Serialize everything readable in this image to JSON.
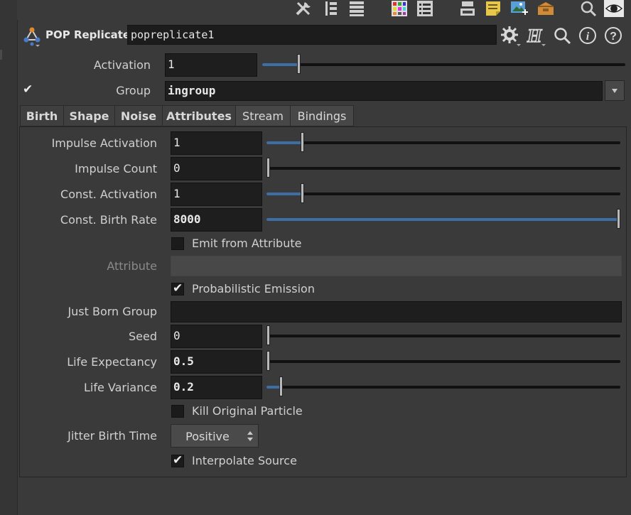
{
  "toolbar": {
    "icons": [
      "tools-icon",
      "tree-list-icon",
      "list-view-icon",
      "color-grid-icon",
      "parameter-list-icon",
      "node-layout-icon",
      "sticky-note-icon",
      "image-add-icon",
      "package-icon",
      "search-icon",
      "eye-icon"
    ]
  },
  "node": {
    "type_label": "POP Replicate",
    "name": "popreplicate1"
  },
  "activation": {
    "label": "Activation",
    "value": "1",
    "fraction": 0.1
  },
  "group": {
    "label": "Group",
    "value": "ingroup",
    "enabled": true
  },
  "tabs": [
    {
      "label": "Birth",
      "bold": true
    },
    {
      "label": "Shape",
      "bold": true
    },
    {
      "label": "Noise",
      "bold": true
    },
    {
      "label": "Attributes",
      "bold": true
    },
    {
      "label": "Stream",
      "bold": false
    },
    {
      "label": "Bindings",
      "bold": false
    }
  ],
  "params": {
    "impulse_activation": {
      "label": "Impulse Activation",
      "value": "1",
      "fraction": 0.1
    },
    "impulse_count": {
      "label": "Impulse Count",
      "value": "0",
      "fraction": 0.0
    },
    "const_activation": {
      "label": "Const. Activation",
      "value": "1",
      "fraction": 0.1
    },
    "const_birth_rate": {
      "label": "Const. Birth Rate",
      "value": "8000",
      "fraction": 1.0
    },
    "emit_from_attribute": {
      "label": "Emit from Attribute",
      "checked": false
    },
    "attribute": {
      "label": "Attribute",
      "value": ""
    },
    "probabilistic_emission": {
      "label": "Probabilistic Emission",
      "checked": true
    },
    "just_born_group": {
      "label": "Just Born Group",
      "value": ""
    },
    "seed": {
      "label": "Seed",
      "value": "0",
      "fraction": 0.0
    },
    "life_expectancy": {
      "label": "Life Expectancy",
      "value": "0.5",
      "fraction": 0.005
    },
    "life_variance": {
      "label": "Life Variance",
      "value": "0.2",
      "fraction": 0.04
    },
    "kill_original_particle": {
      "label": "Kill Original Particle",
      "checked": false
    },
    "jitter_birth_time": {
      "label": "Jitter Birth Time",
      "value": "Positive"
    },
    "interpolate_source": {
      "label": "Interpolate Source",
      "checked": true
    }
  }
}
